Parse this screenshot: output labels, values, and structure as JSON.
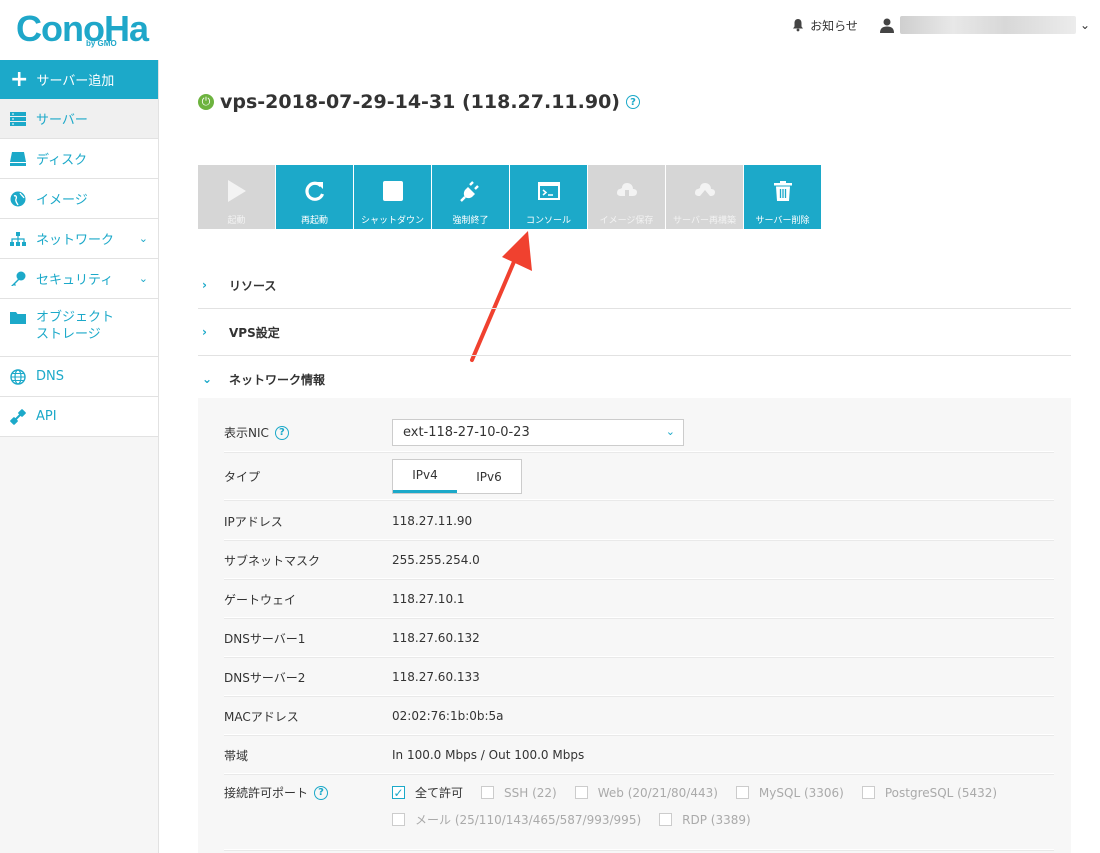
{
  "header": {
    "logo": "ConoHa",
    "logo_sub": "by GMO",
    "notice_label": "お知らせ"
  },
  "sidebar": {
    "add_label": "サーバー追加",
    "items": [
      {
        "label": "サーバー",
        "icon": "server-icon"
      },
      {
        "label": "ディスク",
        "icon": "disk-icon"
      },
      {
        "label": "イメージ",
        "icon": "globe-icon"
      },
      {
        "label": "ネットワーク",
        "icon": "network-icon"
      },
      {
        "label": "セキュリティ",
        "icon": "key-icon"
      },
      {
        "label_line1": "オブジェクト",
        "label_line2": "ストレージ",
        "icon": "folder-icon"
      },
      {
        "label": "DNS",
        "icon": "web-globe-icon"
      },
      {
        "label": "API",
        "icon": "api-icon"
      }
    ]
  },
  "server": {
    "title": "vps-2018-07-29-14-31 (118.27.11.90)",
    "status": "running"
  },
  "toolbar": [
    {
      "label": "起動",
      "icon": "play-icon",
      "enabled": false
    },
    {
      "label": "再起動",
      "icon": "restart-icon",
      "enabled": true
    },
    {
      "label": "シャットダウン",
      "icon": "stop-icon",
      "enabled": true
    },
    {
      "label": "強制終了",
      "icon": "plug-icon",
      "enabled": true
    },
    {
      "label": "コンソール",
      "icon": "console-icon",
      "enabled": true
    },
    {
      "label": "イメージ保存",
      "icon": "download-icon",
      "enabled": false
    },
    {
      "label": "サーバー再構築",
      "icon": "upload-icon",
      "enabled": false
    },
    {
      "label": "サーバー削除",
      "icon": "trash-icon",
      "enabled": true
    }
  ],
  "sections": {
    "resources": "リソース",
    "vps_settings": "VPS設定",
    "network_info": "ネットワーク情報"
  },
  "network": {
    "nic_label": "表示NIC",
    "nic_value": "ext-118-27-10-0-23",
    "type_label": "タイプ",
    "type_tabs": [
      "IPv4",
      "IPv6"
    ],
    "type_selected": "IPv4",
    "ip_label": "IPアドレス",
    "ip_value": "118.27.11.90",
    "subnet_label": "サブネットマスク",
    "subnet_value": "255.255.254.0",
    "gateway_label": "ゲートウェイ",
    "gateway_value": "118.27.10.1",
    "dns1_label": "DNSサーバー1",
    "dns1_value": "118.27.60.132",
    "dns2_label": "DNSサーバー2",
    "dns2_value": "118.27.60.133",
    "mac_label": "MACアドレス",
    "mac_value": "02:02:76:1b:0b:5a",
    "bandwidth_label": "帯域",
    "bandwidth_value": "In 100.0 Mbps / Out 100.0 Mbps",
    "ports_label": "接続許可ポート",
    "ports": [
      {
        "label": "全て許可",
        "checked": true
      },
      {
        "label": "SSH (22)",
        "checked": false
      },
      {
        "label": "Web (20/21/80/443)",
        "checked": false
      },
      {
        "label": "MySQL (3306)",
        "checked": false
      },
      {
        "label": "PostgreSQL (5432)",
        "checked": false
      },
      {
        "label": "メール (25/110/143/465/587/993/995)",
        "checked": false
      },
      {
        "label": "RDP (3389)",
        "checked": false
      }
    ]
  },
  "colors": {
    "accent": "#1ca9c9",
    "disabled": "#d6d6d6",
    "status_green": "#6db33f",
    "annotation_arrow": "#f0412f"
  }
}
